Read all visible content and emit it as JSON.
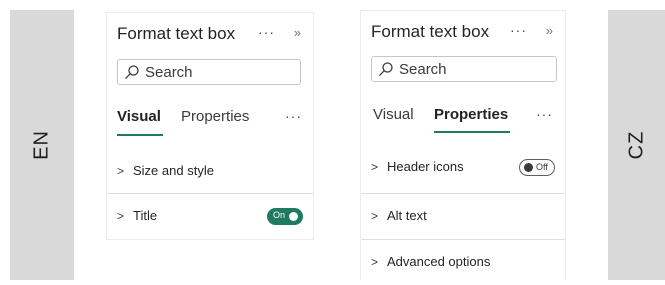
{
  "labels": {
    "left": "EN",
    "right": "CZ"
  },
  "colors": {
    "accent": "#1e7b61",
    "band": "#d9d9d9"
  },
  "en": {
    "title": "Format text box",
    "more": "···",
    "expand": "»",
    "search_placeholder": "Search",
    "tabs": [
      {
        "label": "Visual",
        "active": true
      },
      {
        "label": "Properties",
        "active": false
      }
    ],
    "tabs_more": "···",
    "sections": [
      {
        "label": "Size and style"
      },
      {
        "label": "Title",
        "toggle": "On"
      }
    ]
  },
  "cz": {
    "title": "Format text box",
    "more": "···",
    "expand": "»",
    "search_placeholder": "Search",
    "tabs": [
      {
        "label": "Visual",
        "active": false
      },
      {
        "label": "Properties",
        "active": true
      }
    ],
    "tabs_more": "···",
    "sections": [
      {
        "label": "Header icons",
        "toggle": "Off"
      },
      {
        "label": "Alt text"
      },
      {
        "label": "Advanced options"
      }
    ]
  }
}
